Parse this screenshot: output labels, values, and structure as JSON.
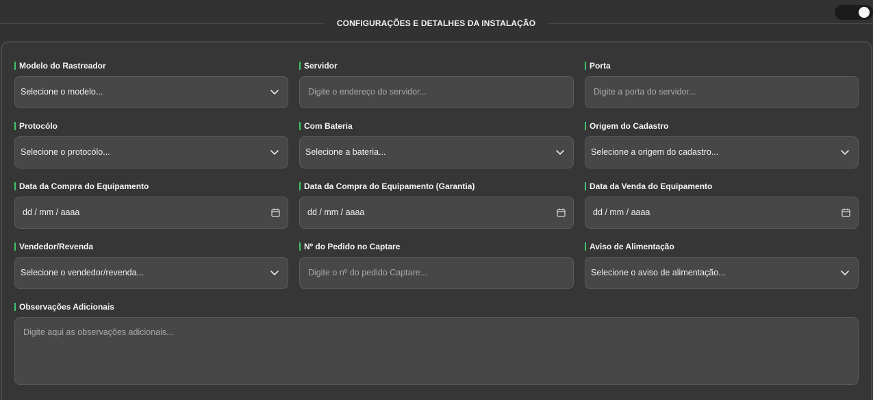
{
  "header": {
    "title": "CONFIGURAÇÕES E DETALHES DA INSTALAÇÃO",
    "toggle_on": true
  },
  "fields": {
    "modelo": {
      "label": "Modelo do Rastreador",
      "value": "Selecione o modelo...",
      "icon": "chevron-down-icon"
    },
    "servidor": {
      "label": "Servidor",
      "placeholder": "Digite o endereço do servidor..."
    },
    "porta": {
      "label": "Porta",
      "placeholder": "Digite a porta do servidor..."
    },
    "protocolo": {
      "label": "Protocólo",
      "value": "Selecione o protocólo...",
      "icon": "chevron-down-icon"
    },
    "bateria": {
      "label": "Com Bateria",
      "value": "Selecione a bateria...",
      "icon": "chevron-down-icon"
    },
    "origem": {
      "label": "Origem do Cadastro",
      "value": "Selecione a origem do cadastro...",
      "icon": "chevron-down-icon"
    },
    "data_compra": {
      "label": "Data da Compra do Equipamento",
      "value": "dd / mm / aaaa",
      "icon": "calendar-icon"
    },
    "data_compra_garantia": {
      "label": "Data da Compra do Equipamento (Garantia)",
      "value": "dd / mm / aaaa",
      "icon": "calendar-icon"
    },
    "data_venda": {
      "label": "Data da Venda do Equipamento",
      "value": "dd / mm / aaaa",
      "icon": "calendar-icon"
    },
    "vendedor": {
      "label": "Vendedor/Revenda",
      "value": "Selecione o vendedor/revenda...",
      "icon": "chevron-down-icon"
    },
    "pedido": {
      "label": "Nº do Pedido no Captare",
      "placeholder": "Digite o nº do pedido Captare..."
    },
    "aviso": {
      "label": "Aviso de Alimentação",
      "value": "Selecione o aviso de alimentação...",
      "icon": "chevron-down-icon"
    },
    "observacoes": {
      "label": "Observações Adicionais",
      "placeholder": "Digite aqui as observações adicionais..."
    }
  },
  "colors": {
    "accent": "#3ec46d",
    "background": "#323232",
    "field_background": "#474747"
  }
}
